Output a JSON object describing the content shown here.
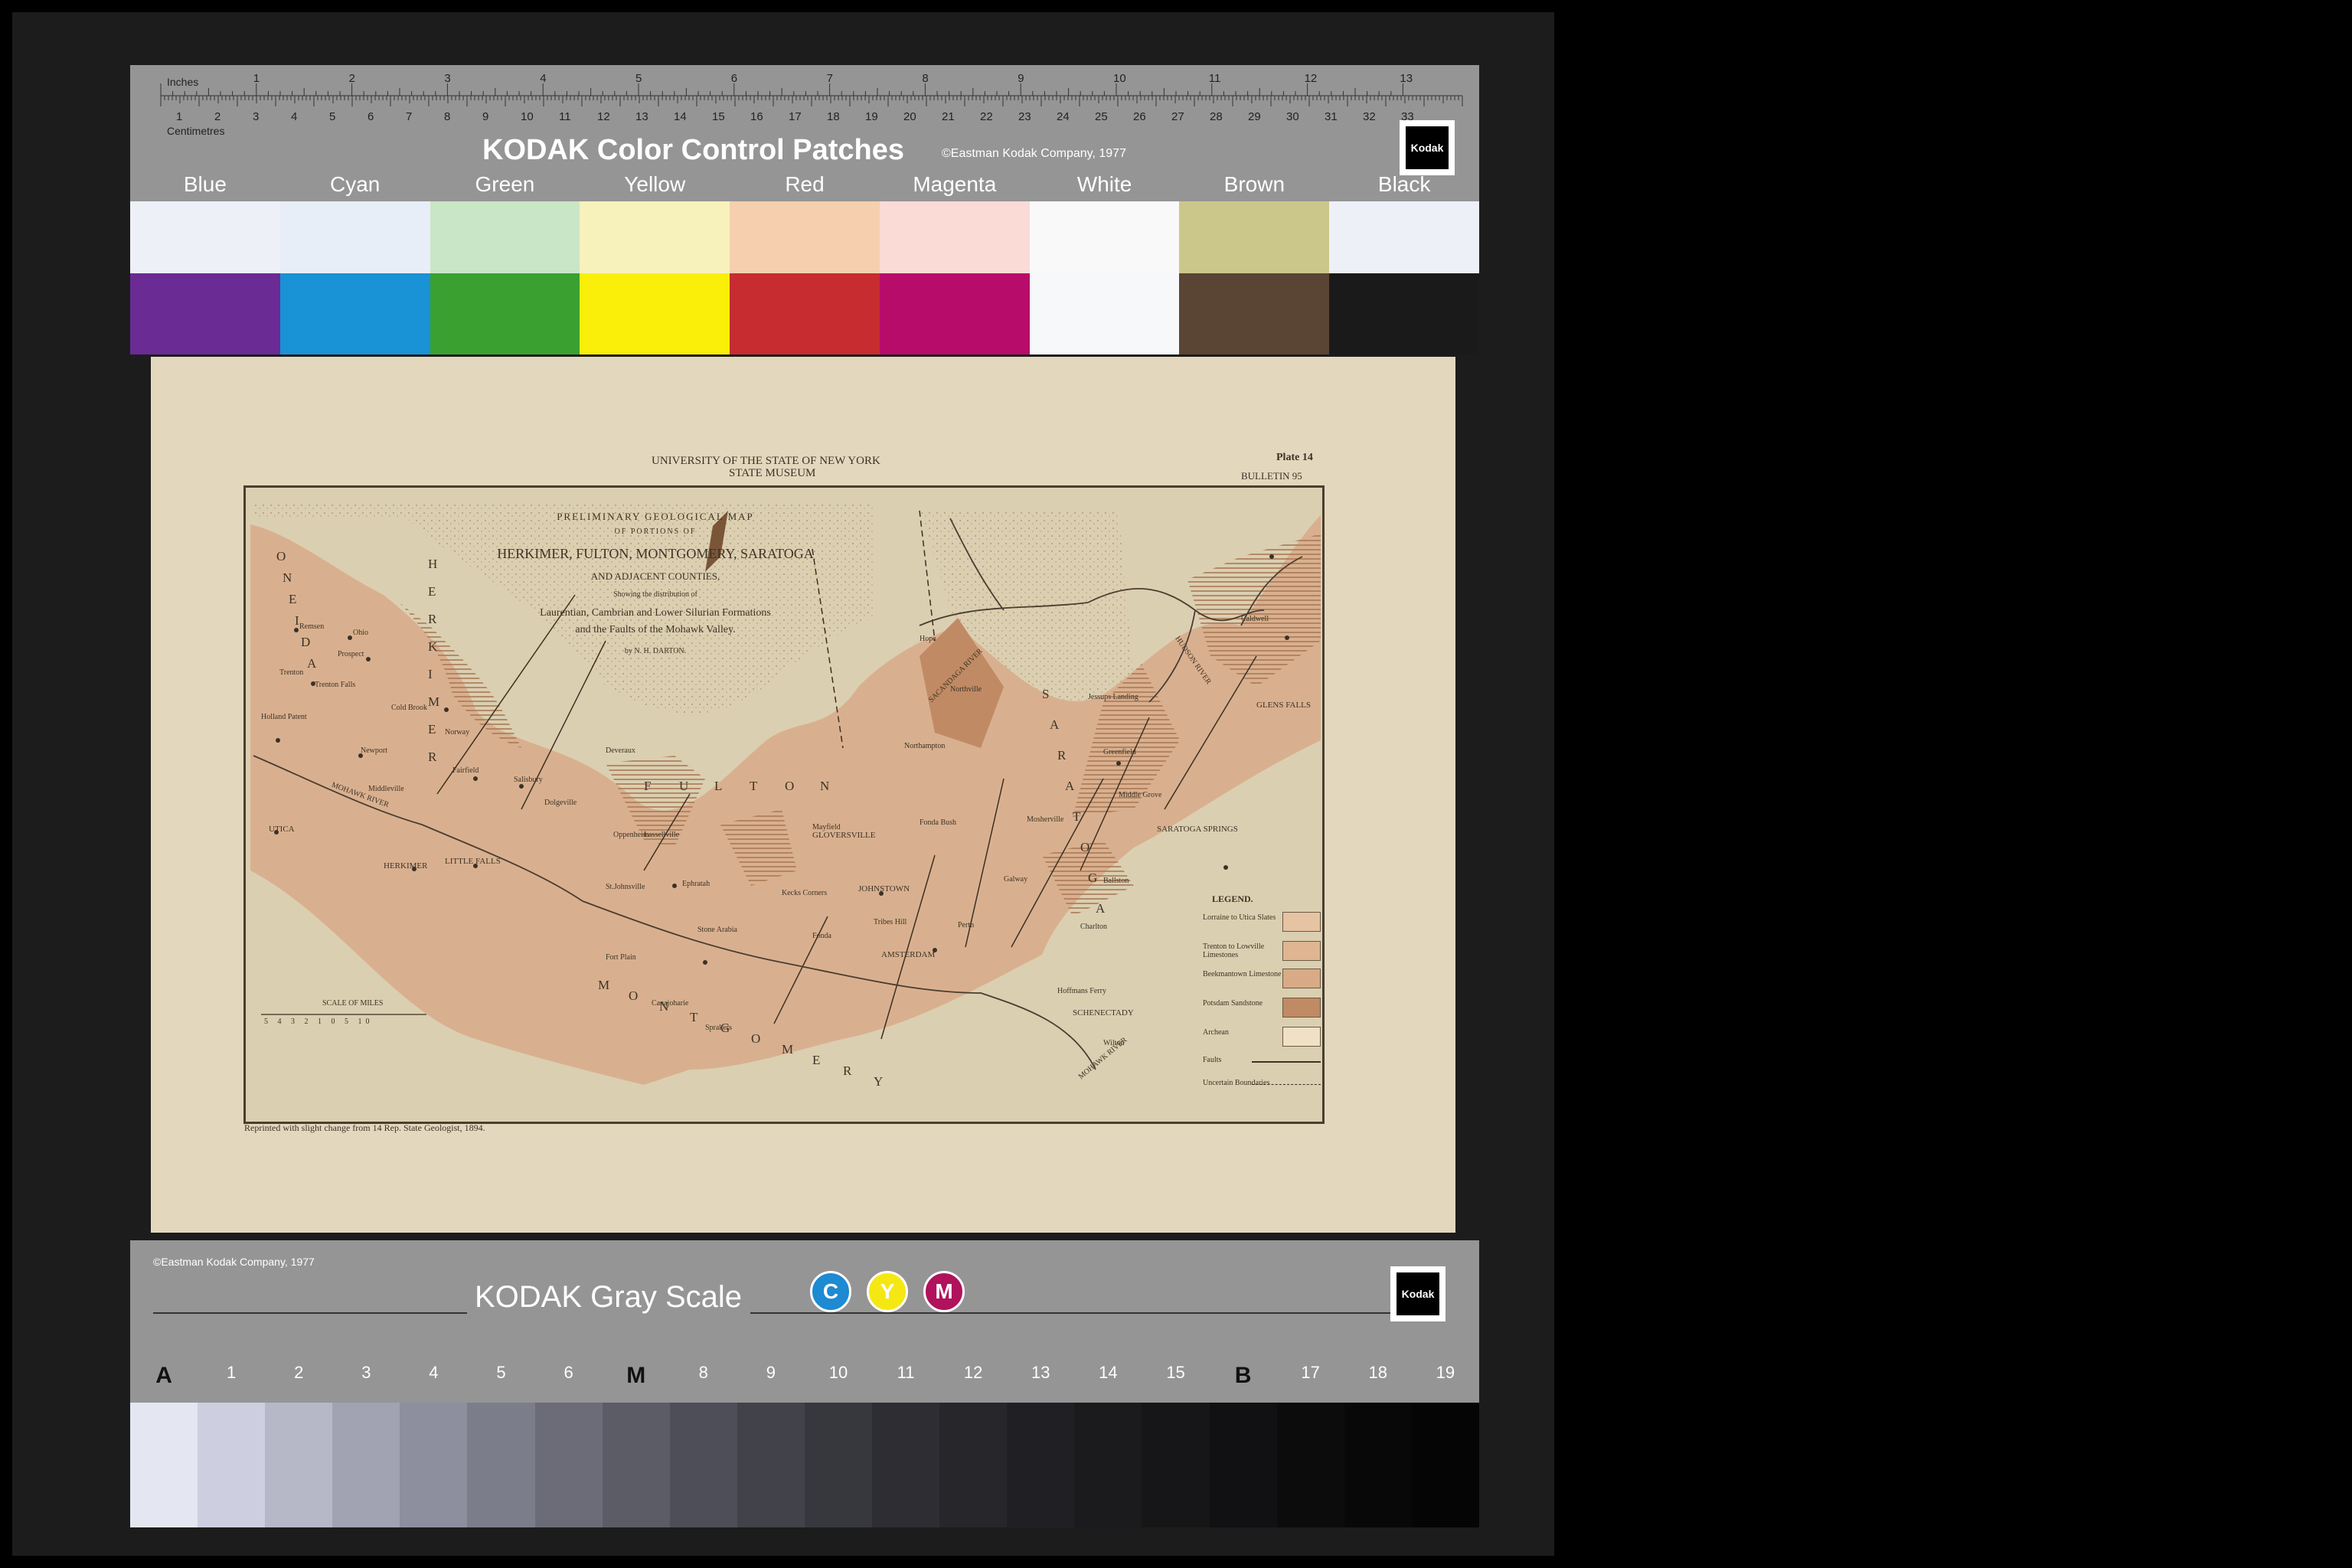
{
  "color_card": {
    "ruler_inches_label": "Inches",
    "ruler_cm_label": "Centimetres",
    "inch_ticks": [
      "1",
      "2",
      "3",
      "4",
      "5",
      "6",
      "7",
      "8",
      "9",
      "10",
      "11",
      "12",
      "13"
    ],
    "cm_ticks": [
      "1",
      "2",
      "3",
      "4",
      "5",
      "6",
      "7",
      "8",
      "9",
      "10",
      "11",
      "12",
      "13",
      "14",
      "15",
      "16",
      "17",
      "18",
      "19",
      "20",
      "21",
      "22",
      "23",
      "24",
      "25",
      "26",
      "27",
      "28",
      "29",
      "30",
      "31",
      "32",
      "33"
    ],
    "title": "KODAK Color Control Patches",
    "copyright": "©Eastman Kodak Company, 1977",
    "logo_text": "Kodak",
    "swatches": [
      {
        "label": "Blue",
        "light": "#eef0f7",
        "dark": "#6a2b94"
      },
      {
        "label": "Cyan",
        "light": "#e8eef7",
        "dark": "#1a92d6"
      },
      {
        "label": "Green",
        "light": "#c9e6c6",
        "dark": "#3aa030"
      },
      {
        "label": "Yellow",
        "light": "#f7f1bc",
        "dark": "#f9ef08"
      },
      {
        "label": "Red",
        "light": "#f6cfae",
        "dark": "#c62c30"
      },
      {
        "label": "Magenta",
        "light": "#fadbd6",
        "dark": "#b80c6a"
      },
      {
        "label": "White",
        "light": "#f9f9fa",
        "dark": "#f7f8fa"
      },
      {
        "label": "Brown",
        "light": "#cbc78a",
        "dark": "#5a4434"
      },
      {
        "label": "Black",
        "light": "#eef0f7",
        "dark": "#1a1a1a"
      }
    ]
  },
  "map_sheet": {
    "header_line1": "UNIVERSITY OF THE STATE OF NEW YORK",
    "header_line2": "STATE MUSEUM",
    "plate": "Plate 14",
    "bulletin": "BULLETIN 95",
    "title_lines": [
      "PRELIMINARY GEOLOGICAL MAP",
      "OF PORTIONS OF",
      "HERKIMER, FULTON, MONTGOMERY, SARATOGA",
      "AND ADJACENT COUNTIES,",
      "Showing the distribution of",
      "Laurentian, Cambrian and Lower Silurian Formations",
      "and the Faults of the Mohawk Valley.",
      "by N. H. DARTON."
    ],
    "footer_note": "Reprinted with slight change from 14 Rep. State Geologist, 1894.",
    "scale_title": "SCALE OF MILES",
    "scale_ticks": [
      "5",
      "4",
      "3",
      "2",
      "1",
      "0",
      "5",
      "10"
    ],
    "legend_title": "LEGEND.",
    "legend": [
      {
        "label": "Lorraine to Utica Slates",
        "color": "#e6c3a3"
      },
      {
        "label": "Trenton to Lowville Limestones",
        "color": "#dfb592"
      },
      {
        "label": "Beekmantown Limestone",
        "color": "#d8aa85"
      },
      {
        "label": "Potsdam Sandstone",
        "color": "#c08a64"
      },
      {
        "label": "Archean",
        "color": "#efe0c6"
      },
      {
        "label": "Faults",
        "color": ""
      },
      {
        "label": "Uncertain Boundaries",
        "color": ""
      }
    ],
    "county_letters": {
      "herkimer": "HERKIMER",
      "fulton": "FULTON",
      "oneida": "ONEIDA",
      "montgomery": "MONTGOMERY",
      "saratoga": "SARATOGA"
    },
    "places": [
      "Remsen",
      "Ohio",
      "Prospect",
      "Trenton",
      "Trenton Falls",
      "Cold Brook",
      "Holland Patent",
      "Norway",
      "Newport",
      "Fairfield",
      "Salisbury",
      "Deveraux",
      "Middleville",
      "Dolgeville",
      "UTICA",
      "Oppenheim",
      "HERKIMER",
      "LITTLE FALLS",
      "Lassellville",
      "Ephratah",
      "St.Johnsville",
      "Stone Arabia",
      "Fort Plain",
      "Canajoharie",
      "Sprakers",
      "GLOVERSVILLE",
      "JOHNSTOWN",
      "Kecks Corners",
      "Tribes Hill",
      "Fonda",
      "AMSTERDAM",
      "Mayfield",
      "Fonda Bush",
      "Perth",
      "Galway",
      "Northampton",
      "Northville",
      "Hope",
      "Jessups Landing",
      "Greenfield",
      "Middle Grove",
      "Mosherville",
      "SARATOGA SPRINGS",
      "Ballston",
      "Charlton",
      "Hoffmans Ferry",
      "SCHENECTADY",
      "Wilton",
      "GLENS FALLS",
      "Caldwell"
    ],
    "rivers": [
      "MOHAWK RIVER",
      "SACANDAGA RIVER",
      "HUDSON RIVER",
      "MOHAWK RIVER"
    ]
  },
  "gray_card": {
    "copyright": "©Eastman Kodak Company, 1977",
    "title": "KODAK Gray Scale",
    "logo_text": "Kodak",
    "cmy": [
      {
        "letter": "C",
        "color": "#1d8ad2"
      },
      {
        "letter": "Y",
        "color": "#f5e812"
      },
      {
        "letter": "M",
        "color": "#b0125c"
      }
    ],
    "step_labels": [
      "A",
      "1",
      "2",
      "3",
      "4",
      "5",
      "6",
      "M",
      "8",
      "9",
      "10",
      "11",
      "12",
      "13",
      "14",
      "15",
      "B",
      "17",
      "18",
      "19"
    ],
    "steps": [
      "#e4e6f2",
      "#cdcfe0",
      "#b6b8c8",
      "#a1a3b2",
      "#8e8f9e",
      "#7c7d8b",
      "#6b6c78",
      "#5c5c67",
      "#4e4e58",
      "#42424a",
      "#37373e",
      "#2d2d33",
      "#26262b",
      "#202024",
      "#1b1b1e",
      "#161618",
      "#111113",
      "#0c0c0d",
      "#080809",
      "#050505"
    ]
  }
}
